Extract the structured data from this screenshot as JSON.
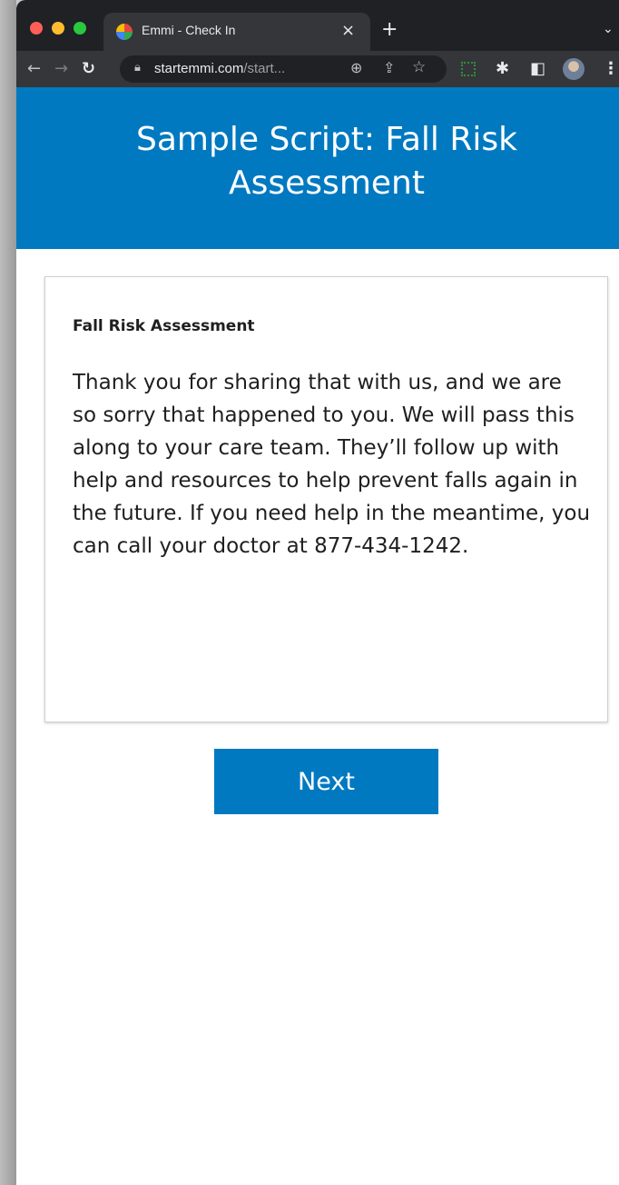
{
  "browser": {
    "tab_title": "Emmi - Check In",
    "tab_close": "×",
    "new_tab": "+",
    "tab_menu": "⌄",
    "url_host": "startemmi.com",
    "url_rest": "/start...",
    "icons": [
      "back-icon",
      "forward-icon",
      "reload-icon",
      "lock-icon",
      "zoom-icon",
      "share-icon",
      "star-icon",
      "extension-icon",
      "puzzle-icon",
      "side-panel-icon",
      "avatar",
      "menu-icon"
    ]
  },
  "page": {
    "header_title": "Sample Script: Fall Risk Assessment",
    "card_heading": "Fall Risk Assessment",
    "card_body": "Thank you for sharing that with us, and we are so sorry that happened to you. We will pass this along to your care team. They’ll follow up with help and resources to help prevent falls again in the future. If you need help in the meantime, you can call your doctor at 877-434-1242.",
    "next_label": "Next"
  },
  "colors": {
    "brand_blue": "#0079c1",
    "chrome_dark": "#202124",
    "chrome_toolbar": "#35363a"
  }
}
